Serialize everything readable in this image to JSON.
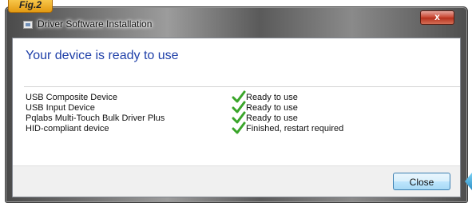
{
  "figure_label": "Fig.2",
  "window": {
    "title": "Driver Software Installation",
    "close_glyph": "x"
  },
  "heading": "Your device is ready to use",
  "devices": [
    {
      "name": "USB Composite Device",
      "status": "Ready to use",
      "icon": "check-icon"
    },
    {
      "name": "USB Input Device",
      "status": "Ready to use",
      "icon": "check-icon"
    },
    {
      "name": "Pqlabs Multi-Touch Bulk Driver Plus",
      "status": "Ready to use",
      "icon": "check-icon"
    },
    {
      "name": "HID-compliant device",
      "status": "Finished, restart required",
      "icon": "check-icon"
    }
  ],
  "footer": {
    "close_label": "Close"
  },
  "colors": {
    "heading": "#1e3fa8",
    "check": "#3aa52a",
    "fig_tab": "#e39a12",
    "close_x": "#c8442e"
  }
}
